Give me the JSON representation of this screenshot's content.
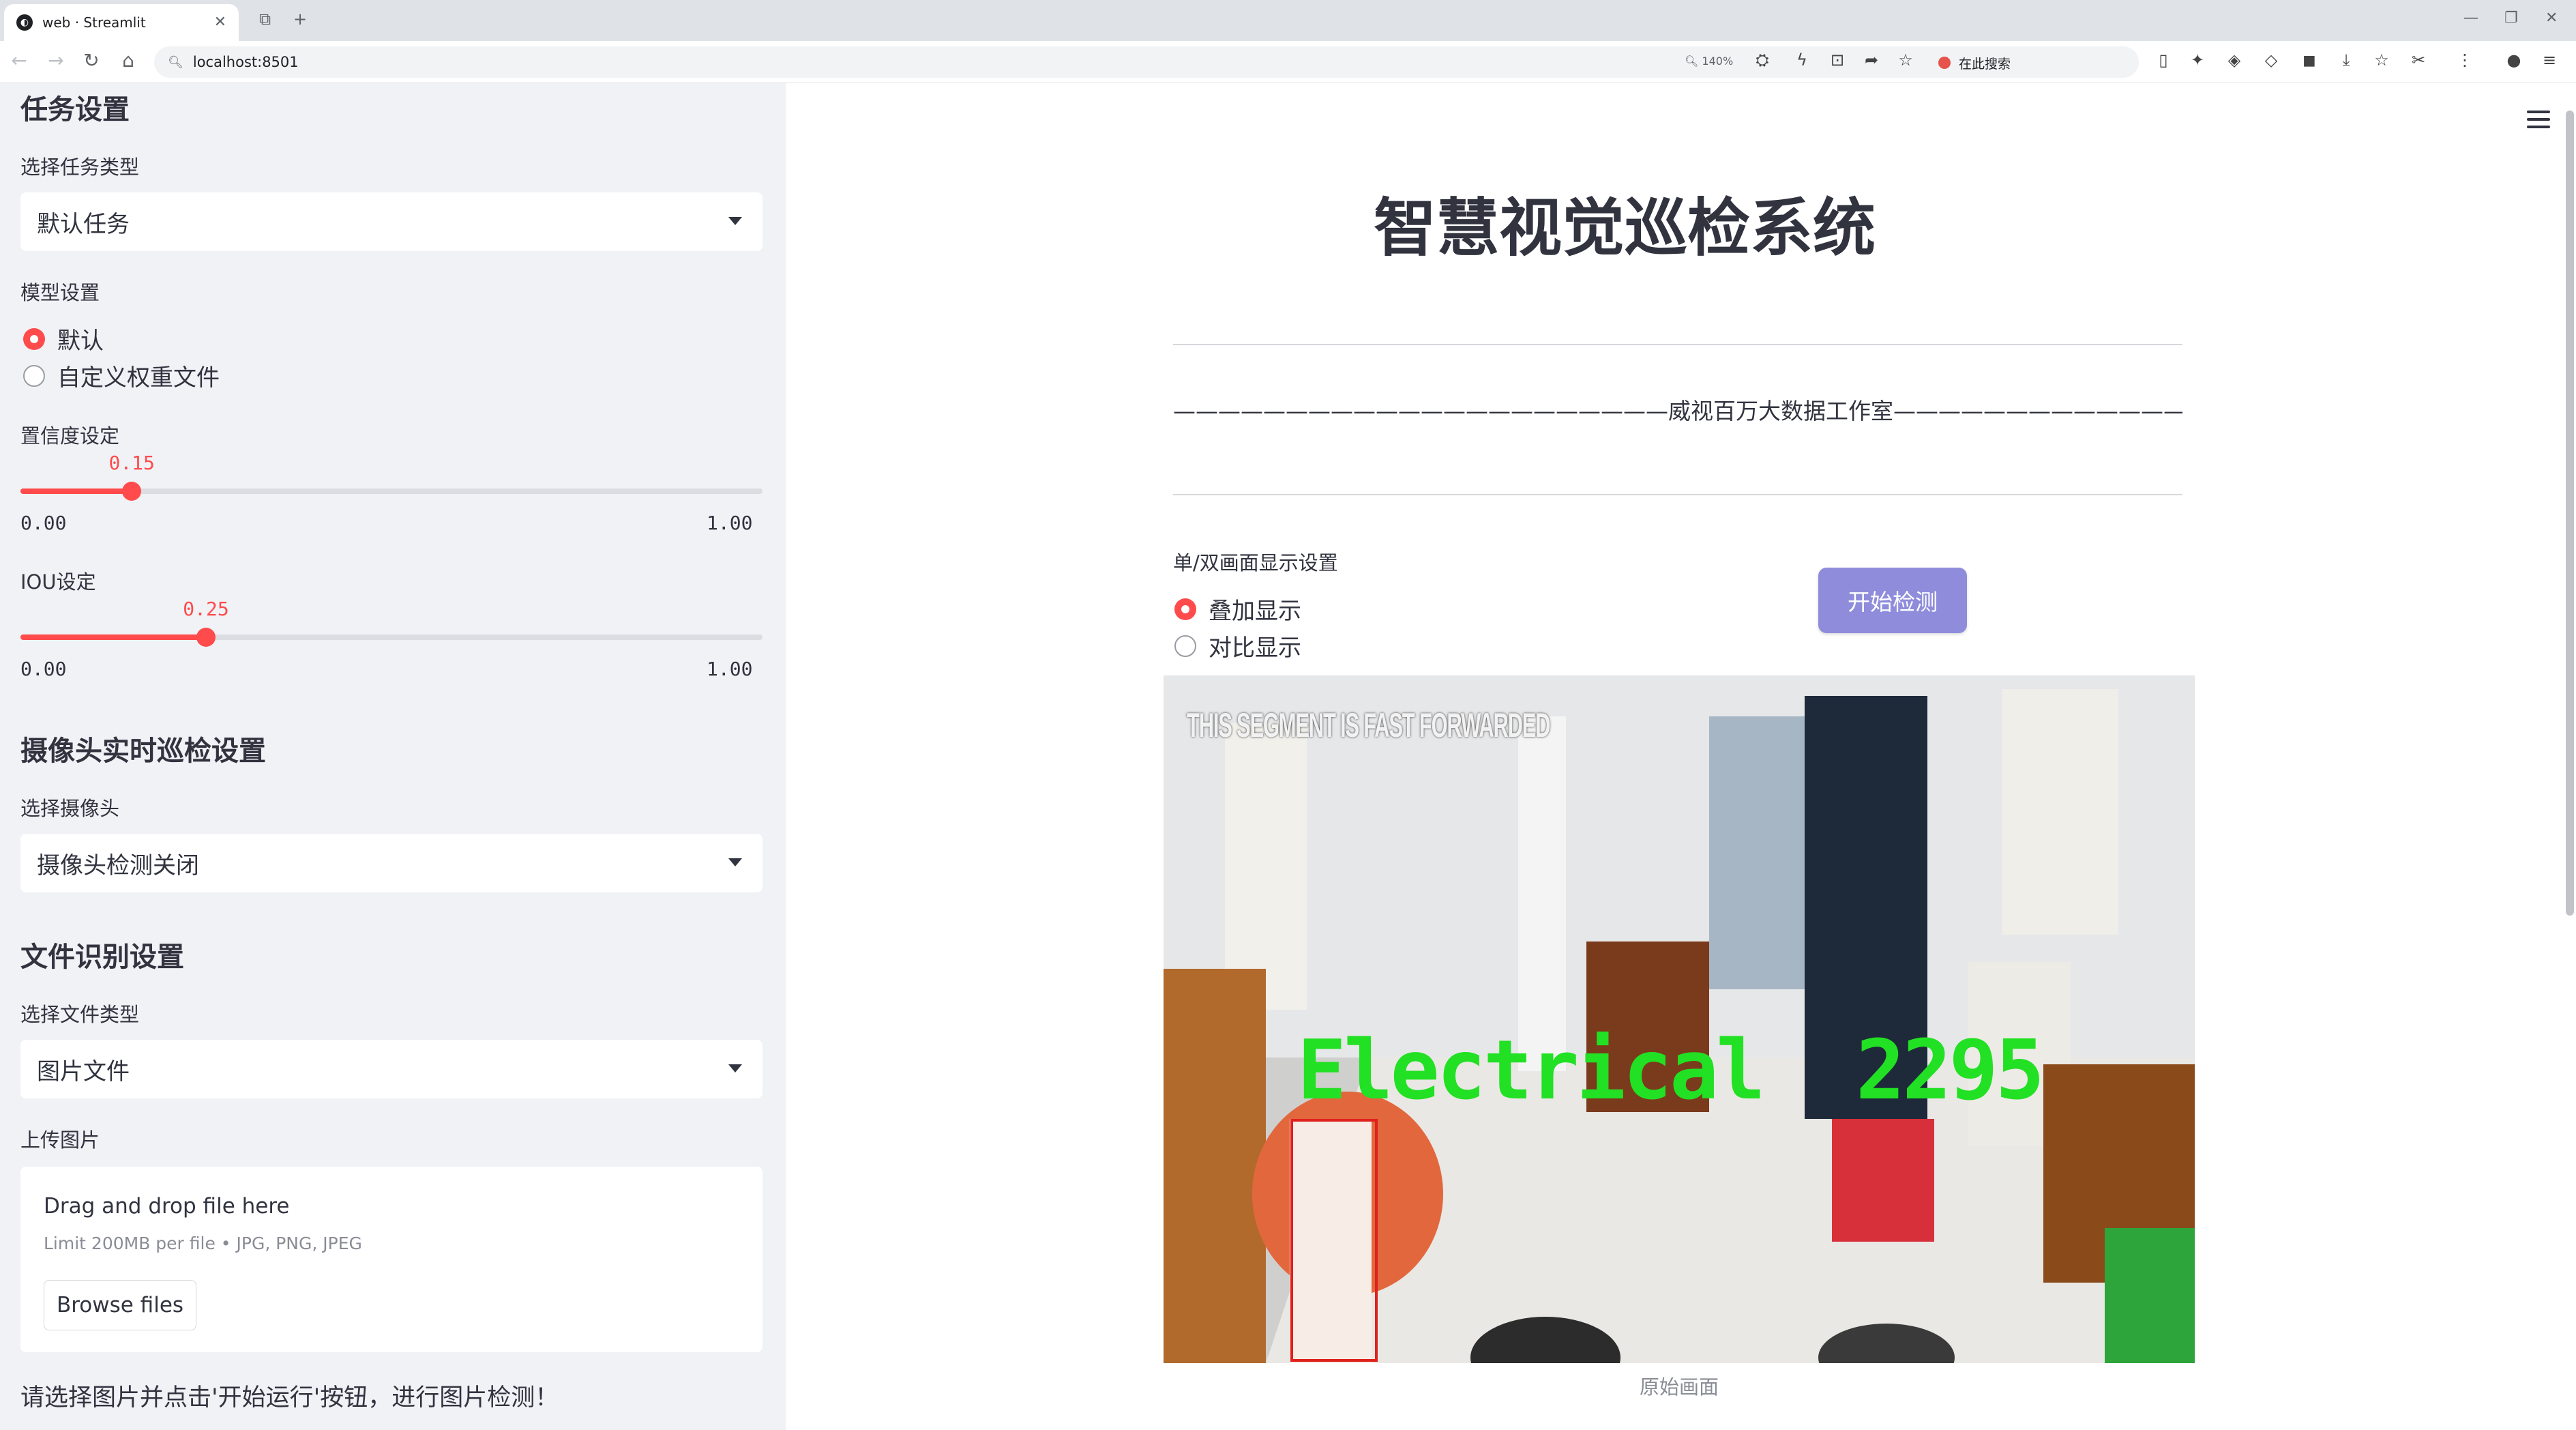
{
  "browser": {
    "tab_title": "web · Streamlit",
    "tab_favicon": "streamlit-logo",
    "url": "localhost:8501",
    "zoom": "140%",
    "search_placeholder": "在此搜索"
  },
  "sidebar": {
    "task_header": "任务设置",
    "task_type_label": "选择任务类型",
    "task_type_value": "默认任务",
    "model_label": "模型设置",
    "model_options": [
      "默认",
      "自定义权重文件"
    ],
    "model_selected": 0,
    "conf_label": "置信度设定",
    "conf": {
      "value": 0.15,
      "display": "0.15",
      "min": "0.00",
      "max": "1.00"
    },
    "iou_label": "IOU设定",
    "iou": {
      "value": 0.25,
      "display": "0.25",
      "min": "0.00",
      "max": "1.00"
    },
    "camera_header": "摄像头实时巡检设置",
    "camera_label": "选择摄像头",
    "camera_value": "摄像头检测关闭",
    "file_header": "文件识别设置",
    "file_type_label": "选择文件类型",
    "file_type_value": "图片文件",
    "upload_label": "上传图片",
    "upload_title": "Drag and drop file here",
    "upload_limit": "Limit 200MB per file • JPG, PNG, JPEG",
    "browse_label": "Browse files",
    "hint": "请选择图片并点击'开始运行'按钮，进行图片检测！"
  },
  "main": {
    "title": "智慧视觉巡检系统",
    "studio": "——————————————————————威视百万大数据工作室———————————————————————",
    "display_label": "单/双画面显示设置",
    "display_options": [
      "叠加显示",
      "对比显示"
    ],
    "display_selected": 0,
    "start_button": "开始检测",
    "frame": {
      "overlay_text": "THIS SEGMENT IS FAST FORWARDED",
      "detection_label": "Electrical  2295",
      "box_color": "#e0201c",
      "label_color": "#22e023"
    },
    "caption": "原始画面"
  },
  "colors": {
    "accent": "#ff4b4b",
    "button": "#8f8ddb",
    "sidebar_bg": "#f0f2f6"
  }
}
